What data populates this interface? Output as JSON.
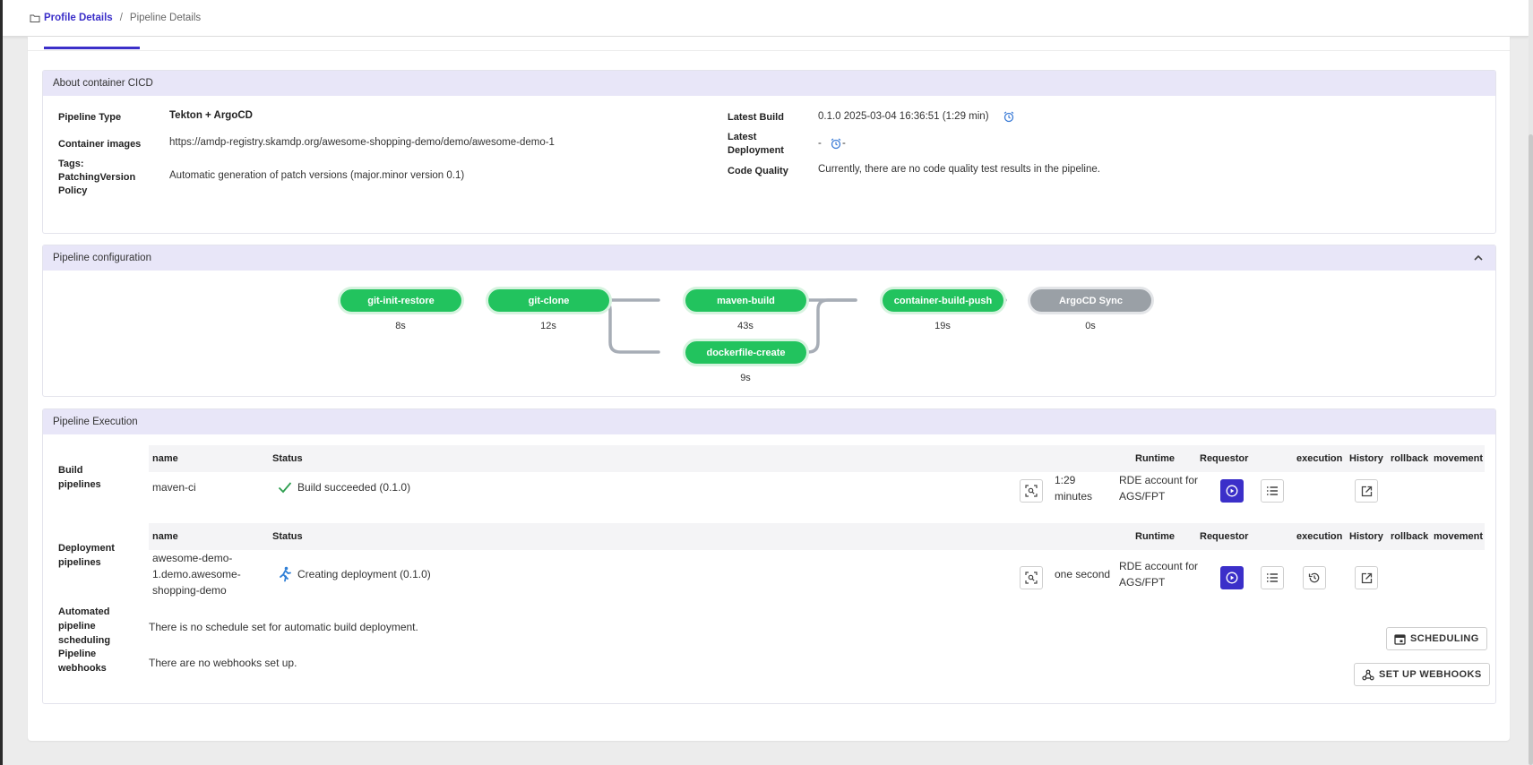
{
  "breadcrumb": {
    "home": "Profile Details",
    "separator": "/",
    "current": "Pipeline Details"
  },
  "about": {
    "title": "About container CICD",
    "pipeline_type_label": "Pipeline Type",
    "pipeline_type": "Tekton + ArgoCD",
    "container_images_label": "Container images",
    "container_images": "https://amdp-registry.skamdp.org/awesome-shopping-demo/demo/awesome-demo-1",
    "tags_label": "Tags:",
    "patching_label_1": "PatchingVersion",
    "patching_label_2": "Policy",
    "patching_value": "Automatic generation of patch versions (major.minor version 0.1)",
    "latest_build_label": "Latest Build",
    "latest_build": "0.1.0 2025-03-04 16:36:51 (1:29 min)",
    "latest_deployment_label_1": "Latest",
    "latest_deployment_label_2": "Deployment",
    "latest_deployment_pre": "-",
    "latest_deployment_post": "-",
    "code_quality_label": "Code Quality",
    "code_quality": "Currently, there are no code quality test results in the pipeline."
  },
  "config": {
    "title": "Pipeline configuration",
    "stages": [
      {
        "name": "git-init-restore",
        "time": "8s",
        "status": "success"
      },
      {
        "name": "git-clone",
        "time": "12s",
        "status": "success"
      },
      {
        "name": "maven-build",
        "time": "43s",
        "status": "success"
      },
      {
        "name": "dockerfile-create",
        "time": "9s",
        "status": "success"
      },
      {
        "name": "container-build-push",
        "time": "19s",
        "status": "success"
      },
      {
        "name": "ArgoCD Sync",
        "time": "0s",
        "status": "pending"
      }
    ]
  },
  "execution": {
    "title": "Pipeline Execution",
    "columns": [
      "name",
      "Status",
      "Runtime",
      "Requestor",
      "execution",
      "History",
      "rollback",
      "movement"
    ],
    "build": {
      "label_1": "Build",
      "label_2": "pipelines",
      "name": "maven-ci",
      "status": "Build succeeded (0.1.0)",
      "runtime_1": "1:29",
      "runtime_2": "minutes",
      "requestor_1": "RDE account for",
      "requestor_2": "AGS/FPT"
    },
    "deploy": {
      "label_1": "Deployment",
      "label_2": "pipelines",
      "name_1": "awesome-demo-",
      "name_2": "1.demo.awesome-",
      "name_3": "shopping-demo",
      "status": "Creating deployment (0.1.0)",
      "runtime": "one second",
      "requestor_1": "RDE account for",
      "requestor_2": "AGS/FPT"
    },
    "schedule": {
      "label_1": "Automated",
      "label_2": "pipeline",
      "label_3": "scheduling",
      "text": "There is no schedule set for automatic build deployment.",
      "button": "SCHEDULING"
    },
    "webhooks": {
      "label_1": "Pipeline",
      "label_2": "webhooks",
      "text": "There are no webhooks set up.",
      "button": "SET UP WEBHOOKS"
    }
  },
  "colors": {
    "accent": "#3b2fc9",
    "success": "#22c35e",
    "pending": "#9aa0a6",
    "section_header": "#e8e6f8"
  },
  "icons": [
    "folder-icon",
    "alarm-clock-icon",
    "chevron-up-icon",
    "checkmark-icon",
    "running-person-icon",
    "inspect-icon",
    "play-icon",
    "list-icon",
    "history-icon",
    "external-link-icon",
    "calendar-icon",
    "webhook-icon"
  ]
}
